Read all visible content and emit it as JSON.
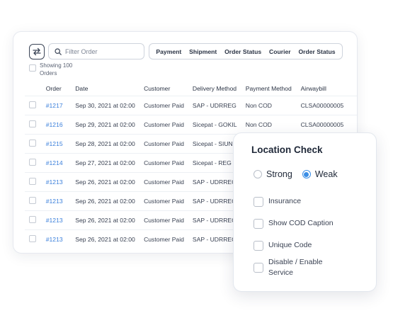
{
  "toolbar": {
    "search_placeholder": "Filter Order",
    "filters": [
      "Payment",
      "Shipment",
      "Order Status",
      "Courier",
      "Order Status"
    ]
  },
  "showing": {
    "label": "Showing 100 Orders"
  },
  "table": {
    "headers": [
      "Order",
      "Date",
      "Customer",
      "Delivery Method",
      "Payment Method",
      "Airwaybill"
    ],
    "rows": [
      [
        "#1217",
        "Sep 30, 2021 at 02:00",
        "Customer Paid",
        "SAP - UDRREG",
        "Non COD",
        "CLSA00000005"
      ],
      [
        "#1216",
        "Sep 29, 2021 at 02:00",
        "Customer Paid",
        "Sicepat - GOKIL",
        "Non COD",
        "CLSA00000005"
      ],
      [
        "#1215",
        "Sep 28, 2021 at 02:00",
        "Customer Paid",
        "Sicepat - SIUNT",
        "",
        ""
      ],
      [
        "#1214",
        "Sep 27, 2021 at 02:00",
        "Customer Paid",
        "Sicepat - REG",
        "",
        ""
      ],
      [
        "#1213",
        "Sep 26, 2021 at 02:00",
        "Customer Paid",
        "SAP - UDRREG",
        "",
        ""
      ],
      [
        "#1213",
        "Sep 26, 2021 at 02:00",
        "Customer Paid",
        "SAP - UDRREG",
        "",
        ""
      ],
      [
        "#1213",
        "Sep 26, 2021 at 02:00",
        "Customer Paid",
        "SAP - UDRREG",
        "",
        ""
      ],
      [
        "#1213",
        "Sep 26, 2021 at 02:00",
        "Customer Paid",
        "SAP - UDRREG",
        "",
        ""
      ]
    ]
  },
  "location_check": {
    "title": "Location Check",
    "radios": [
      {
        "label": "Strong",
        "selected": false
      },
      {
        "label": "Weak",
        "selected": true
      }
    ],
    "options": [
      "Insurance",
      "Show COD Caption",
      "Unique Code",
      "Disable / Enable Service"
    ]
  },
  "colors": {
    "accent": "#3a8ee6",
    "link": "#3a7fdb"
  }
}
